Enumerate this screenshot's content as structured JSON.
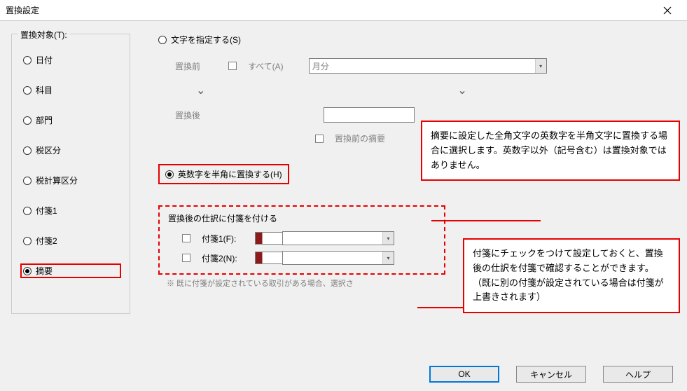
{
  "window": {
    "title": "置換設定"
  },
  "group": {
    "title": "置換対象(T):"
  },
  "targets": {
    "date": "日付",
    "account": "科目",
    "dept": "部門",
    "taxcat": "税区分",
    "taxcalc": "税計算区分",
    "tag1": "付箋1",
    "tag2": "付箋2",
    "summary": "摘要"
  },
  "mode": {
    "specify": "文字を指定する(S)",
    "halfwidth": "英数字を半角に置換する(H)"
  },
  "fields": {
    "before": "置換前",
    "allLabel": "すべて(A)",
    "monthValue": "月分",
    "after": "置換後",
    "keepSummary": "置換前の摘要"
  },
  "tagbox": {
    "title": "置換後の仕訳に付箋を付ける",
    "tag1": "付箋1(F):",
    "tag2": "付箋2(N):",
    "note": "※ 既に付箋が設定されている取引がある場合、選択さ"
  },
  "callout1": "摘要に設定した全角文字の英数字を半角文字に置換する場合に選択します。英数字以外（記号含む）は置換対象ではありません。",
  "callout2": "付箋にチェックをつけて設定しておくと、置換後の仕訳を付箋で確認することができます。\n（既に別の付箋が設定されている場合は付箋が上書きされます）",
  "buttons": {
    "ok": "OK",
    "cancel": "キャンセル",
    "help": "ヘルプ"
  }
}
